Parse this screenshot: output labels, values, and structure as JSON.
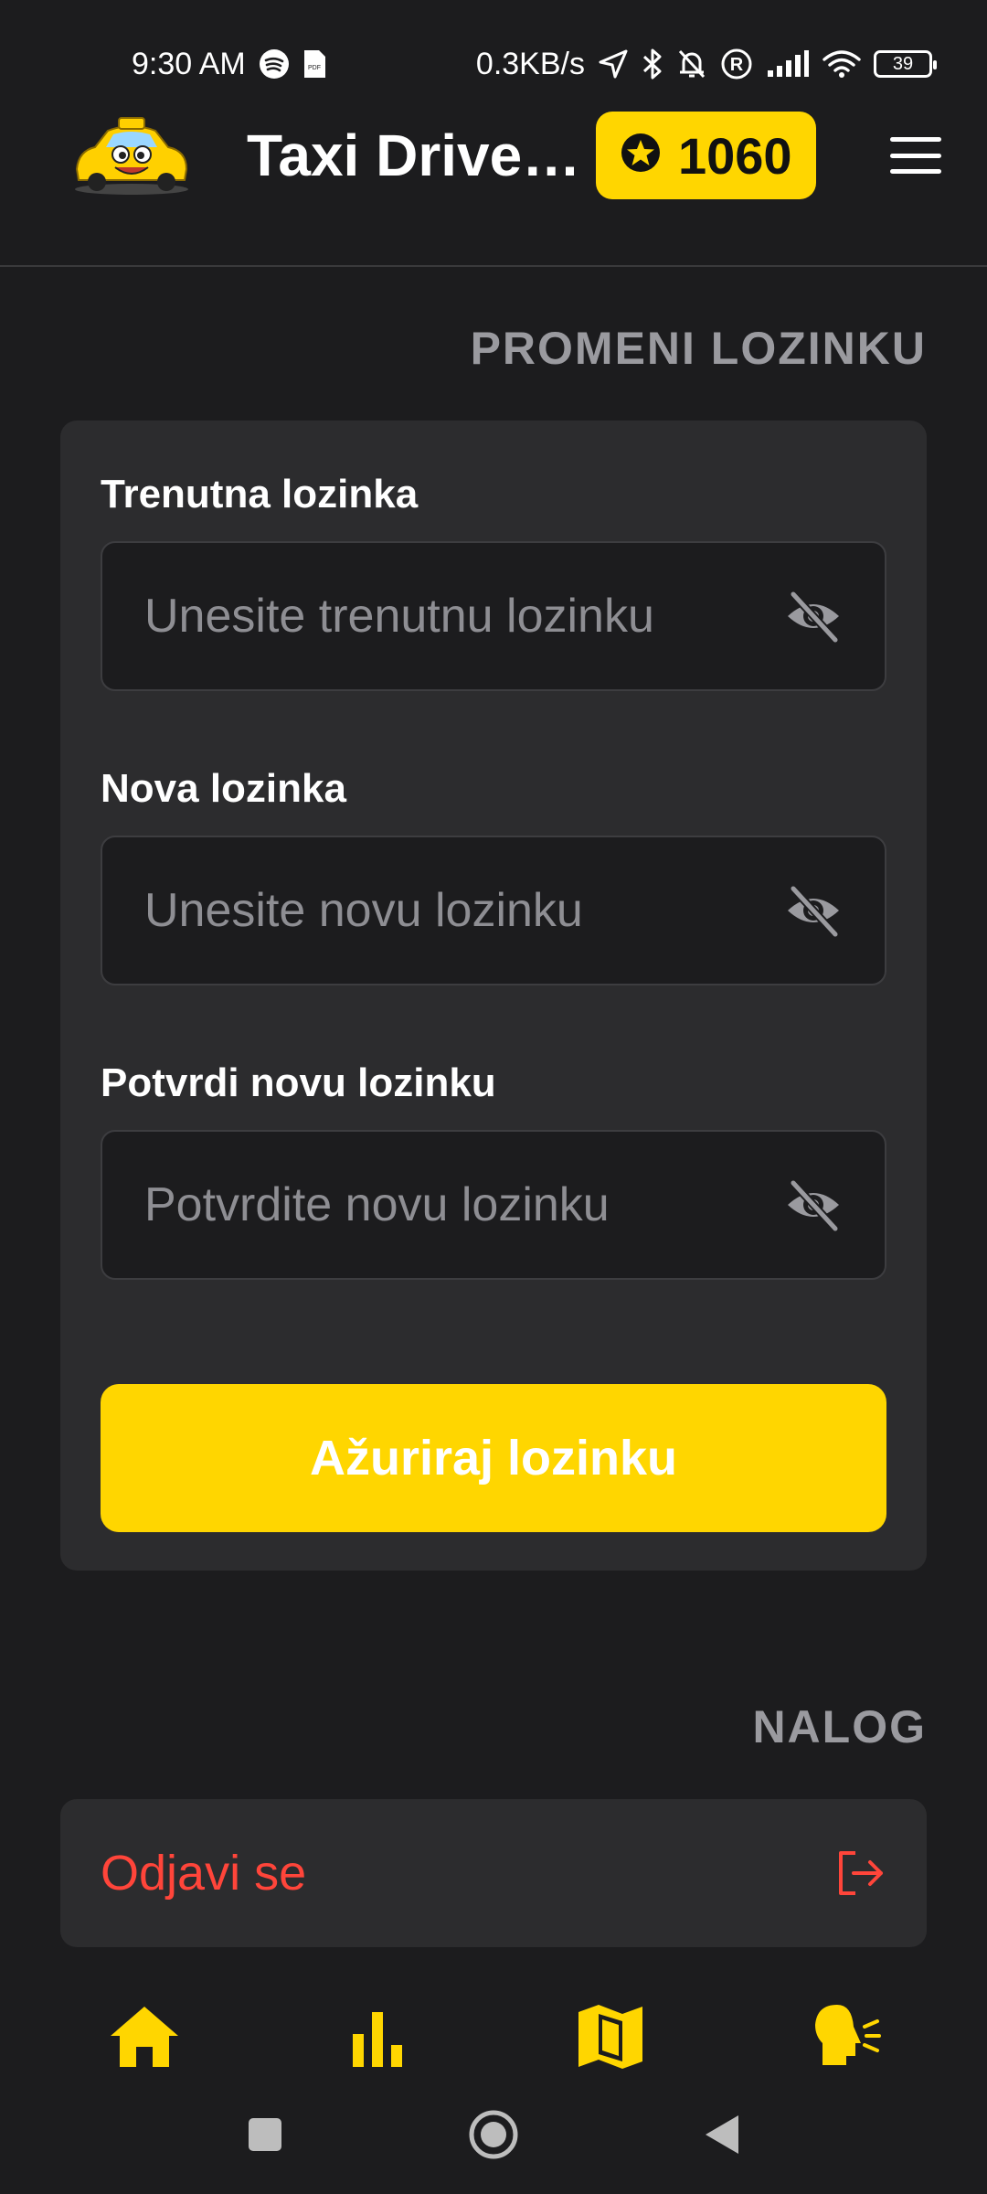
{
  "status_bar": {
    "time": "9:30 AM",
    "network_speed": "0.3KB/s",
    "battery": "39",
    "icons": [
      "spotify-icon",
      "pdf-icon",
      "location-arrow-icon",
      "bluetooth-icon",
      "bell-off-icon",
      "registered-icon",
      "signal-icon",
      "wifi-icon",
      "battery-icon"
    ]
  },
  "header": {
    "title": "Taxi Driver Pro",
    "points": "1060",
    "logo": "taxi-cartoon-logo",
    "menu_icon": "hamburger-icon"
  },
  "password_section": {
    "title": "PROMENI LOZINKU",
    "fields": [
      {
        "label": "Trenutna lozinka",
        "placeholder": "Unesite trenutnu lozinku",
        "value": ""
      },
      {
        "label": "Nova lozinka",
        "placeholder": "Unesite novu lozinku",
        "value": ""
      },
      {
        "label": "Potvrdi novu lozinku",
        "placeholder": "Potvrdite novu lozinku",
        "value": ""
      }
    ],
    "submit_label": "Ažuriraj lozinku"
  },
  "account_section": {
    "title": "NALOG",
    "logout_label": "Odjavi se"
  },
  "bottom_nav": {
    "items": [
      "home-icon",
      "stats-icon",
      "map-icon",
      "voice-icon"
    ]
  },
  "colors": {
    "accent": "#ffd600",
    "background": "#1c1c1e",
    "card": "#2c2c2e",
    "danger": "#ff453a",
    "muted": "#9a9a9f"
  }
}
